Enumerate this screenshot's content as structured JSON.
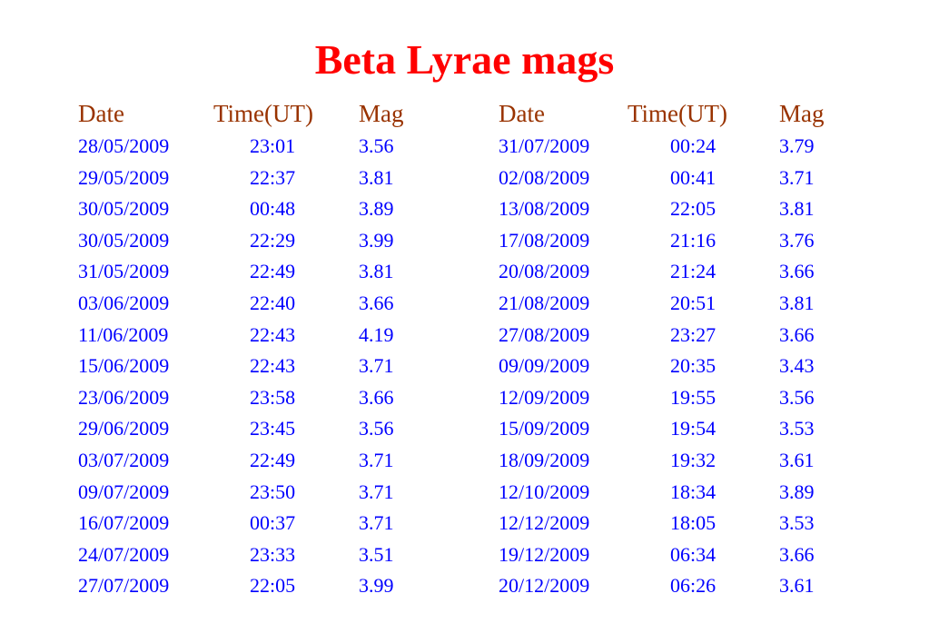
{
  "title": "Beta Lyrae mags",
  "headers": {
    "date": "Date",
    "time": "Time(UT)",
    "mag": "Mag"
  },
  "left_rows": [
    {
      "date": "28/05/2009",
      "time": "23:01",
      "mag": "3.56"
    },
    {
      "date": "29/05/2009",
      "time": "22:37",
      "mag": "3.81"
    },
    {
      "date": "30/05/2009",
      "time": "00:48",
      "mag": "3.89"
    },
    {
      "date": "30/05/2009",
      "time": "22:29",
      "mag": "3.99"
    },
    {
      "date": "31/05/2009",
      "time": "22:49",
      "mag": "3.81"
    },
    {
      "date": "03/06/2009",
      "time": "22:40",
      "mag": "3.66"
    },
    {
      "date": "11/06/2009",
      "time": "22:43",
      "mag": "4.19"
    },
    {
      "date": "15/06/2009",
      "time": "22:43",
      "mag": "3.71"
    },
    {
      "date": "23/06/2009",
      "time": "23:58",
      "mag": "3.66"
    },
    {
      "date": "29/06/2009",
      "time": "23:45",
      "mag": "3.56"
    },
    {
      "date": "03/07/2009",
      "time": "22:49",
      "mag": "3.71"
    },
    {
      "date": "09/07/2009",
      "time": "23:50",
      "mag": "3.71"
    },
    {
      "date": "16/07/2009",
      "time": "00:37",
      "mag": "3.71"
    },
    {
      "date": "24/07/2009",
      "time": "23:33",
      "mag": "3.51"
    },
    {
      "date": "27/07/2009",
      "time": "22:05",
      "mag": "3.99"
    }
  ],
  "right_rows": [
    {
      "date": "31/07/2009",
      "time": "00:24",
      "mag": "3.79"
    },
    {
      "date": "02/08/2009",
      "time": "00:41",
      "mag": "3.71"
    },
    {
      "date": "13/08/2009",
      "time": "22:05",
      "mag": "3.81"
    },
    {
      "date": "17/08/2009",
      "time": "21:16",
      "mag": "3.76"
    },
    {
      "date": "20/08/2009",
      "time": "21:24",
      "mag": "3.66"
    },
    {
      "date": "21/08/2009",
      "time": "20:51",
      "mag": "3.81"
    },
    {
      "date": "27/08/2009",
      "time": "23:27",
      "mag": "3.66"
    },
    {
      "date": "09/09/2009",
      "time": "20:35",
      "mag": "3.43"
    },
    {
      "date": "12/09/2009",
      "time": "19:55",
      "mag": "3.56"
    },
    {
      "date": "15/09/2009",
      "time": "19:54",
      "mag": "3.53"
    },
    {
      "date": "18/09/2009",
      "time": "19:32",
      "mag": "3.61"
    },
    {
      "date": "12/10/2009",
      "time": "18:34",
      "mag": "3.89"
    },
    {
      "date": "12/12/2009",
      "time": "18:05",
      "mag": "3.53"
    },
    {
      "date": "19/12/2009",
      "time": "06:34",
      "mag": "3.66"
    },
    {
      "date": "20/12/2009",
      "time": "06:26",
      "mag": "3.61"
    }
  ],
  "colors": {
    "title": "#ff0000",
    "header": "#993300",
    "cell": "#0000ff"
  }
}
